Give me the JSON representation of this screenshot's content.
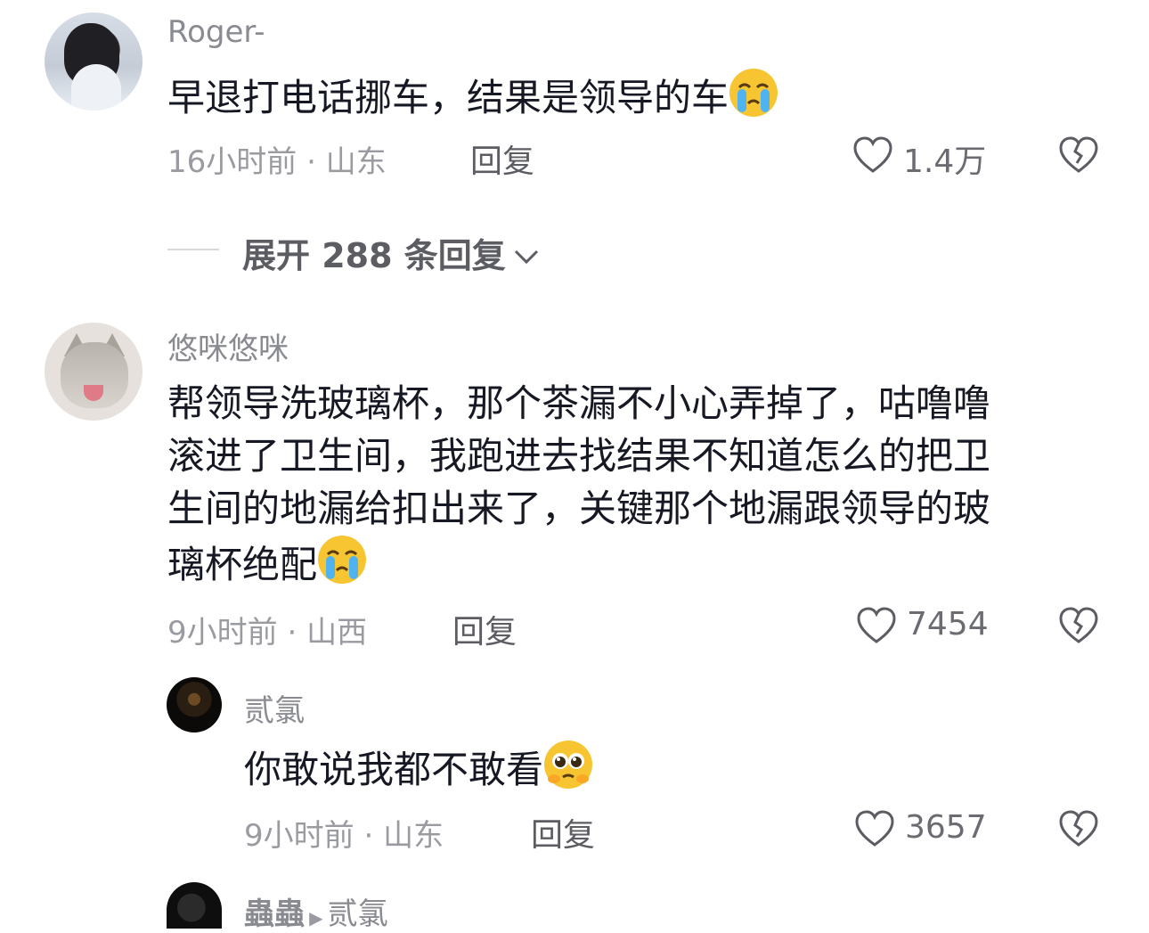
{
  "comments": [
    {
      "username": "Roger-",
      "text": "早退打电话挪车，结果是领导的车",
      "emoji": "crying-face",
      "time": "16小时前",
      "location": "山东",
      "reply_label": "回复",
      "likes": "1.4万"
    },
    {
      "username": "悠咪悠咪",
      "text_lines": [
        "帮领导洗玻璃杯，那个茶漏不小心弄掉了，咕噜噜",
        "滚进了卫生间，我跑进去找结果不知道怎么的把卫",
        "生间的地漏给扣出来了，关键那个地漏跟领导的玻",
        "璃杯绝配"
      ],
      "emoji": "crying-face",
      "time": "9小时前",
      "location": "山西",
      "reply_label": "回复",
      "likes": "7454"
    }
  ],
  "expand": {
    "label": "展开 288 条回复"
  },
  "replies": [
    {
      "username": "贰氯",
      "text": "你敢说我都不敢看",
      "emoji": "pleading-face",
      "time": "9小时前",
      "location": "山东",
      "reply_label": "回复",
      "likes": "3657"
    },
    {
      "username": "蟲蟲",
      "reply_to": "贰氯"
    }
  ],
  "separator": " · ",
  "colors": {
    "text": "#161823",
    "meta": "#9a9ba1",
    "username": "#8a8b91"
  }
}
